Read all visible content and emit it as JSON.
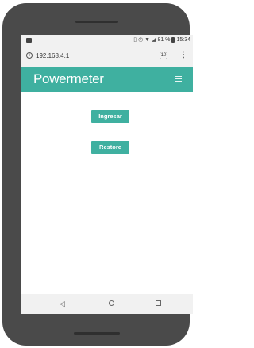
{
  "status_bar": {
    "battery_text": "81 %",
    "time": "15:34",
    "icons": [
      "image-icon",
      "vibrate-icon",
      "alarm-icon",
      "wifi-icon",
      "signal-icon",
      "battery-icon"
    ]
  },
  "browser": {
    "url": "192.168.4.1",
    "tab_count": "10",
    "icons": [
      "info-icon",
      "tabs-icon",
      "overflow-menu-icon"
    ]
  },
  "app": {
    "title": "Powermeter",
    "accent_color": "#3fb0a0",
    "menu_icon": "hamburger-icon"
  },
  "buttons": {
    "ingresar_label": "Ingresar",
    "restore_label": "Restore"
  },
  "nav_bar": {
    "icons": [
      "back-icon",
      "home-icon",
      "recents-icon"
    ]
  }
}
